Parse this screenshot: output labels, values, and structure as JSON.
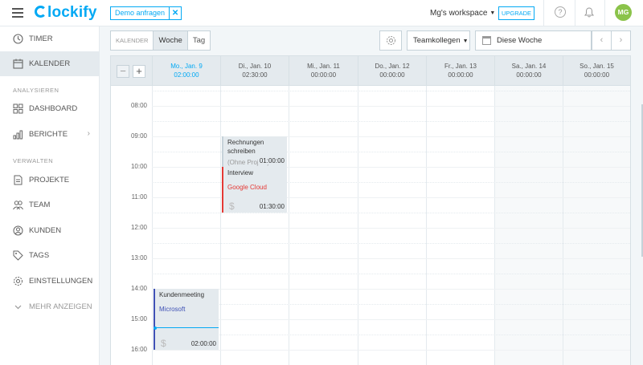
{
  "header": {
    "logo_text": "lockify",
    "demo_label": "Demo anfragen",
    "demo_close": "✕",
    "workspace": "Mg's workspace",
    "upgrade": "UPGRADE",
    "help_icon": "?",
    "avatar": "MG"
  },
  "sidebar": {
    "items": [
      {
        "label": "TIMER",
        "icon": "clock-icon"
      },
      {
        "label": "KALENDER",
        "icon": "calendar-icon",
        "active": true
      }
    ],
    "section_analyze": "ANALYSIEREN",
    "analyze_items": [
      {
        "label": "DASHBOARD",
        "icon": "dashboard-icon"
      },
      {
        "label": "BERICHTE",
        "icon": "reports-icon"
      }
    ],
    "section_manage": "VERWALTEN",
    "manage_items": [
      {
        "label": "PROJEKTE",
        "icon": "projects-icon"
      },
      {
        "label": "TEAM",
        "icon": "team-icon"
      },
      {
        "label": "KUNDEN",
        "icon": "clients-icon"
      },
      {
        "label": "TAGS",
        "icon": "tag-icon"
      },
      {
        "label": "EINSTELLUNGEN",
        "icon": "settings-icon"
      }
    ],
    "more": "MEHR ANZEIGEN"
  },
  "toolbar": {
    "tab_calendar": "KALENDER",
    "tab_week": "Woche",
    "tab_day": "Tag",
    "team": "Teamkollegen",
    "week_range": "Diese Woche",
    "prev": "‹",
    "next": "›"
  },
  "calendar": {
    "zoom_out": "−",
    "zoom_in": "+",
    "days": [
      {
        "name": "Mo., Jan. 9",
        "total": "02:00:00",
        "today": true
      },
      {
        "name": "Di., Jan. 10",
        "total": "02:30:00"
      },
      {
        "name": "Mi., Jan. 11",
        "total": "00:00:00"
      },
      {
        "name": "Do., Jan. 12",
        "total": "00:00:00"
      },
      {
        "name": "Fr., Jan. 13",
        "total": "00:00:00"
      },
      {
        "name": "Sa., Jan. 14",
        "total": "00:00:00"
      },
      {
        "name": "So., Jan. 15",
        "total": "00:00:00"
      }
    ],
    "hours": [
      "08:00",
      "09:00",
      "10:00",
      "11:00",
      "12:00",
      "13:00",
      "14:00",
      "15:00",
      "16:00"
    ],
    "events": [
      {
        "title": "Rechnungen schreiben",
        "project": "(Ohne Projekt)",
        "duration": "01:00:00",
        "accent": "#c6d2d9",
        "project_color": "#999999"
      },
      {
        "title": "Interview",
        "project": "Google Cloud",
        "duration": "01:30:00",
        "accent": "#e53935",
        "project_color": "#e53935"
      },
      {
        "title": "Kundenmeeting",
        "project": "Microsoft",
        "duration": "02:00:00",
        "accent": "#3f51b5",
        "project_color": "#3f51b5"
      }
    ]
  },
  "colors": {
    "brand": "#03a9f4",
    "avatar_bg": "#8bc34a"
  }
}
